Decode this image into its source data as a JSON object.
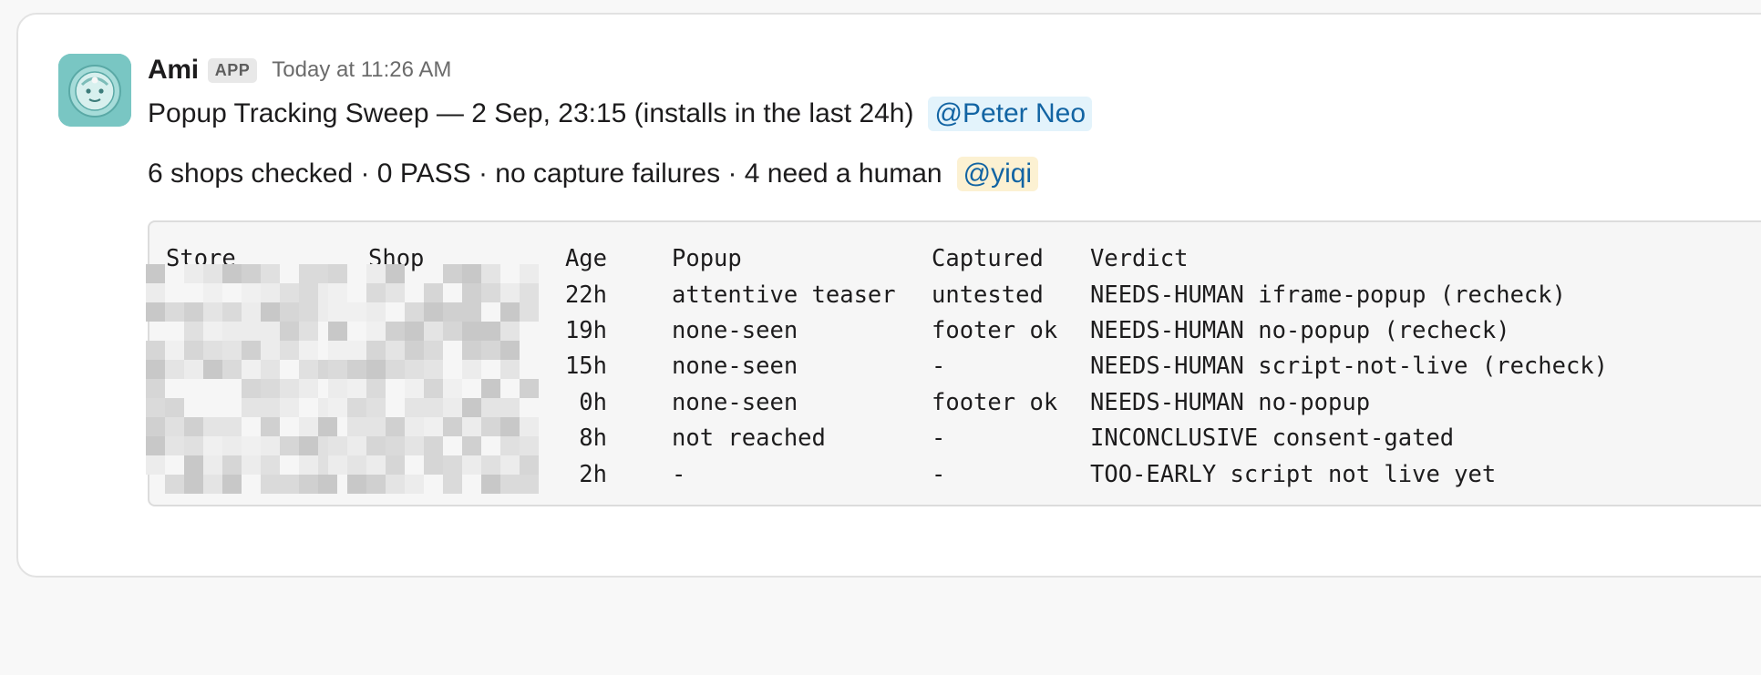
{
  "message": {
    "sender": "Ami",
    "app_badge": "APP",
    "timestamp": "Today at 11:26 AM",
    "line1": "Popup Tracking Sweep — 2 Sep, 23:15 (installs in the last 24h)",
    "mention1": "@Peter Neo",
    "line2": "6 shops checked · 0 PASS · no capture failures · 4 need a human",
    "mention2": "@yiqi"
  },
  "table": {
    "headers": {
      "store": "Store",
      "shop": "Shop",
      "age": "Age",
      "popup": "Popup",
      "captured": "Captured",
      "verdict": "Verdict"
    },
    "rows": [
      {
        "age": "22h",
        "popup": "attentive teaser",
        "captured": "untested",
        "verdict": "NEEDS-HUMAN iframe-popup (recheck)"
      },
      {
        "age": "19h",
        "popup": "none-seen",
        "captured": "footer ok",
        "verdict": "NEEDS-HUMAN no-popup (recheck)"
      },
      {
        "age": "15h",
        "popup": "none-seen",
        "captured": "-",
        "verdict": "NEEDS-HUMAN script-not-live (recheck)"
      },
      {
        "age": "0h",
        "popup": "none-seen",
        "captured": "footer ok",
        "verdict": "NEEDS-HUMAN no-popup"
      },
      {
        "age": "8h",
        "popup": "not reached",
        "captured": "-",
        "verdict": "INCONCLUSIVE consent-gated"
      },
      {
        "age": "2h",
        "popup": "-",
        "captured": "-",
        "verdict": "TOO-EARLY script not live yet"
      }
    ]
  },
  "icons": {
    "avatar": "robot-avatar-icon"
  },
  "colors": {
    "mention_text": "#1264a3",
    "mention_blue_bg": "#e3f3fb",
    "mention_yellow_bg": "#fcf1d2",
    "avatar_bg": "#79c6c3"
  }
}
